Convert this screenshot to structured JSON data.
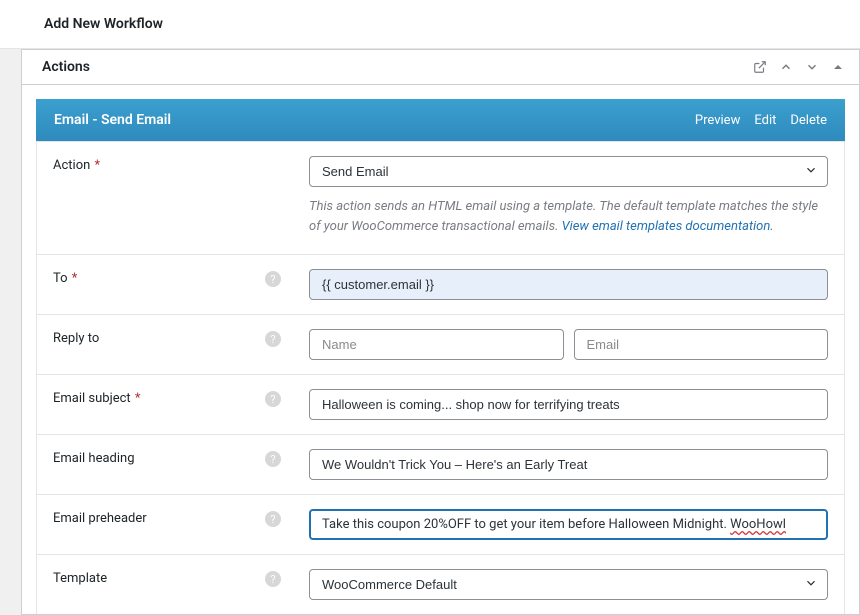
{
  "page": {
    "title": "Add New Workflow"
  },
  "postbox": {
    "title": "Actions"
  },
  "action_header": {
    "title": "Email - Send Email",
    "links": {
      "preview": "Preview",
      "edit": "Edit",
      "delete": "Delete"
    }
  },
  "form": {
    "action": {
      "label": "Action",
      "value": "Send Email",
      "description_pre": "This action sends an HTML email using a template. The default template matches the style of your WooCommerce transactional emails. ",
      "description_link": "View email templates documentation."
    },
    "to": {
      "label": "To",
      "value": "{{ customer.email }}"
    },
    "reply_to": {
      "label": "Reply to",
      "name_placeholder": "Name",
      "email_placeholder": "Email",
      "name_value": "",
      "email_value": ""
    },
    "subject": {
      "label": "Email subject",
      "value": "Halloween is coming... shop now for terrifying treats"
    },
    "heading": {
      "label": "Email heading",
      "value": "We Wouldn't Trick You – Here's an Early Treat"
    },
    "preheader": {
      "label": "Email preheader",
      "value_pre": "Take this coupon 20%OFF to get your item before Halloween Midnight. ",
      "value_spell": "WooHowl"
    },
    "template": {
      "label": "Template",
      "value": "WooCommerce Default"
    }
  }
}
